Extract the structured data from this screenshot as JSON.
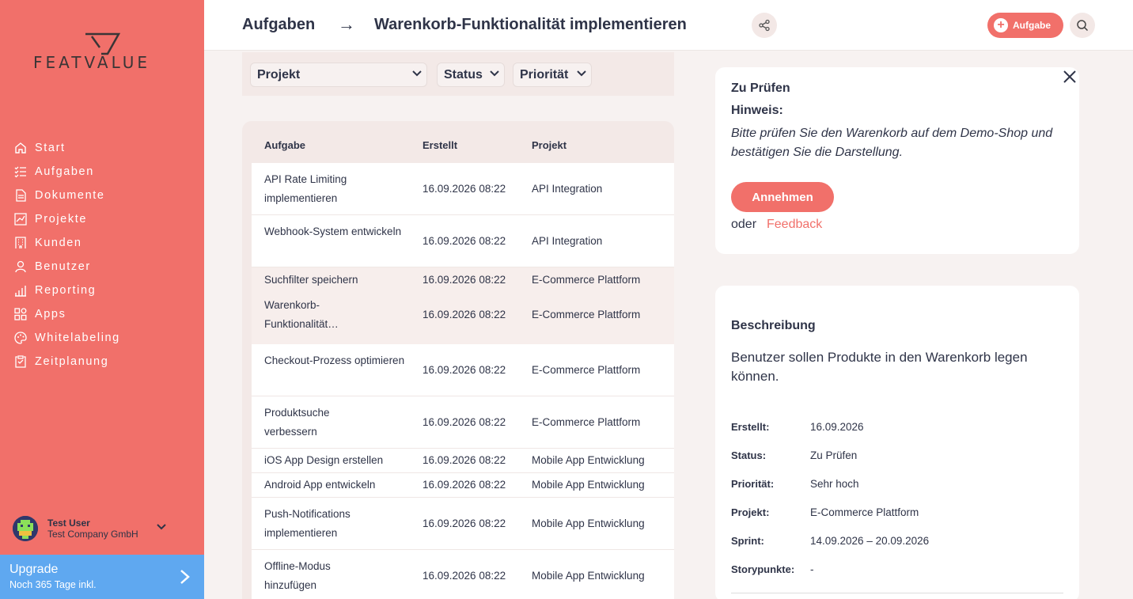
{
  "brand": {
    "name": "FEATVALUE"
  },
  "sidebar": {
    "items": [
      {
        "label": "Start",
        "icon": "home-icon"
      },
      {
        "label": "Aufgaben",
        "icon": "checklist-icon"
      },
      {
        "label": "Dokumente",
        "icon": "document-icon"
      },
      {
        "label": "Projekte",
        "icon": "chart-icon"
      },
      {
        "label": "Kunden",
        "icon": "building-icon"
      },
      {
        "label": "Benutzer",
        "icon": "user-icon"
      },
      {
        "label": "Reporting",
        "icon": "bar-chart-icon"
      },
      {
        "label": "Apps",
        "icon": "apps-icon"
      },
      {
        "label": "Whitelabeling",
        "icon": "palette-icon"
      },
      {
        "label": "Zeitplanung",
        "icon": "clipboard-icon"
      }
    ],
    "user": {
      "name": "Test User",
      "company": "Test Company GmbH"
    },
    "upgrade": {
      "title": "Upgrade",
      "subtitle": "Noch 365 Tage inkl."
    }
  },
  "header": {
    "breadcrumb": "Aufgaben",
    "arrow": "→",
    "title": "Warenkorb-Funktionalität implementieren",
    "add_label": "Aufgabe"
  },
  "filters": {
    "project": "Projekt",
    "status": "Status",
    "priority": "Priorität"
  },
  "table": {
    "columns": [
      "Aufgabe",
      "Erstellt",
      "Projekt"
    ],
    "rows": [
      {
        "task": "API Rate Limiting implementieren",
        "created": "16.09.2026 08:22",
        "project": "API Integration"
      },
      {
        "task": "Webhook-System entwickeln",
        "created": "16.09.2026 08:22",
        "project": "API Integration"
      },
      {
        "task": "Suchfilter speichern",
        "created": "16.09.2026 08:22",
        "project": "E-Commerce Plattform"
      },
      {
        "task": "Warenkorb-Funktionalität…",
        "created": "16.09.2026 08:22",
        "project": "E-Commerce Plattform"
      },
      {
        "task": "Checkout-Prozess optimieren",
        "created": "16.09.2026 08:22",
        "project": "E-Commerce Plattform"
      },
      {
        "task": "Produktsuche verbessern",
        "created": "16.09.2026 08:22",
        "project": "E-Commerce Plattform"
      },
      {
        "task": "iOS App Design erstellen",
        "created": "16.09.2026 08:22",
        "project": "Mobile App Entwicklung"
      },
      {
        "task": "Android App entwickeln",
        "created": "16.09.2026 08:22",
        "project": "Mobile App Entwicklung"
      },
      {
        "task": "Push-Notifications implementieren",
        "created": "16.09.2026 08:22",
        "project": "Mobile App Entwicklung"
      },
      {
        "task": "Offline-Modus hinzufügen",
        "created": "16.09.2026 08:22",
        "project": "Mobile App Entwicklung"
      }
    ]
  },
  "status_card": {
    "title": "Zu Prüfen",
    "hint_label": "Hinweis:",
    "hint_text": "Bitte prüfen Sie den Warenkorb auf dem Demo-Shop und bestätigen Sie die Darstellung.",
    "accept_label": "Annehmen",
    "or_label": "oder",
    "feedback_label": "Feedback"
  },
  "description": {
    "title": "Beschreibung",
    "text": "Benutzer sollen Produkte in den Warenkorb legen können.",
    "fields": [
      {
        "label": "Erstellt:",
        "value": "16.09.2026"
      },
      {
        "label": "Status:",
        "value": "Zu Prüfen"
      },
      {
        "label": "Priorität:",
        "value": "Sehr hoch"
      },
      {
        "label": "Projekt:",
        "value": "E-Commerce Plattform"
      },
      {
        "label": "Sprint:",
        "value": "14.09.2026 – 20.09.2026"
      },
      {
        "label": "Storypunkte:",
        "value": "-"
      }
    ]
  },
  "colors": {
    "accent": "#f1706a",
    "upgrade": "#5fa8f0",
    "text": "#2f3448"
  }
}
